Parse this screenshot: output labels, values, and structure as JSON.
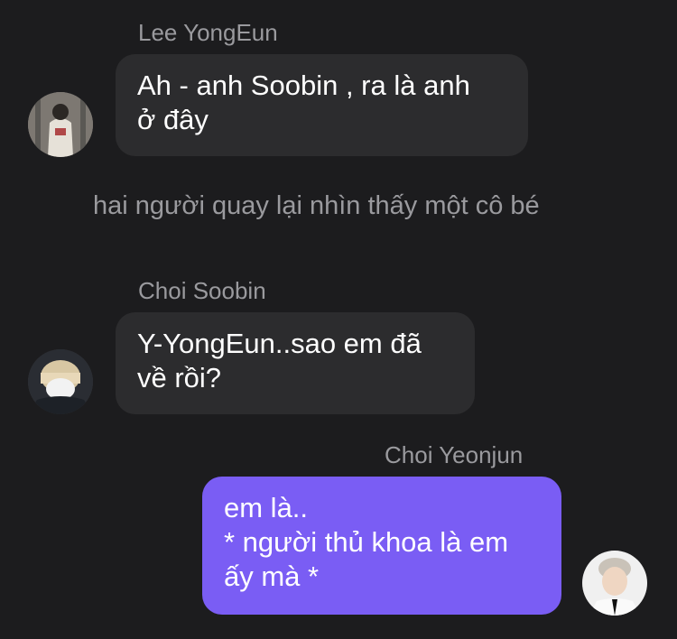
{
  "messages": [
    {
      "sender": "Lee YongEun",
      "lines": [
        "Ah - anh Soobin , ra là anh",
        "ở đây"
      ]
    },
    {
      "narration": "hai người quay lại nhìn thấy một cô bé"
    },
    {
      "sender": "Choi Soobin",
      "lines": [
        "Y-YongEun..sao em đã",
        "về rồi?"
      ]
    },
    {
      "sender": "Choi Yeonjun",
      "lines": [
        "em là..",
        "* người thủ khoa là em",
        "ấy mà *"
      ]
    }
  ],
  "colors": {
    "background": "#1c1c1e",
    "incoming_bubble": "#2c2c2e",
    "outgoing_bubble": "#7a5df4",
    "secondary_text": "#9a9a9e"
  }
}
